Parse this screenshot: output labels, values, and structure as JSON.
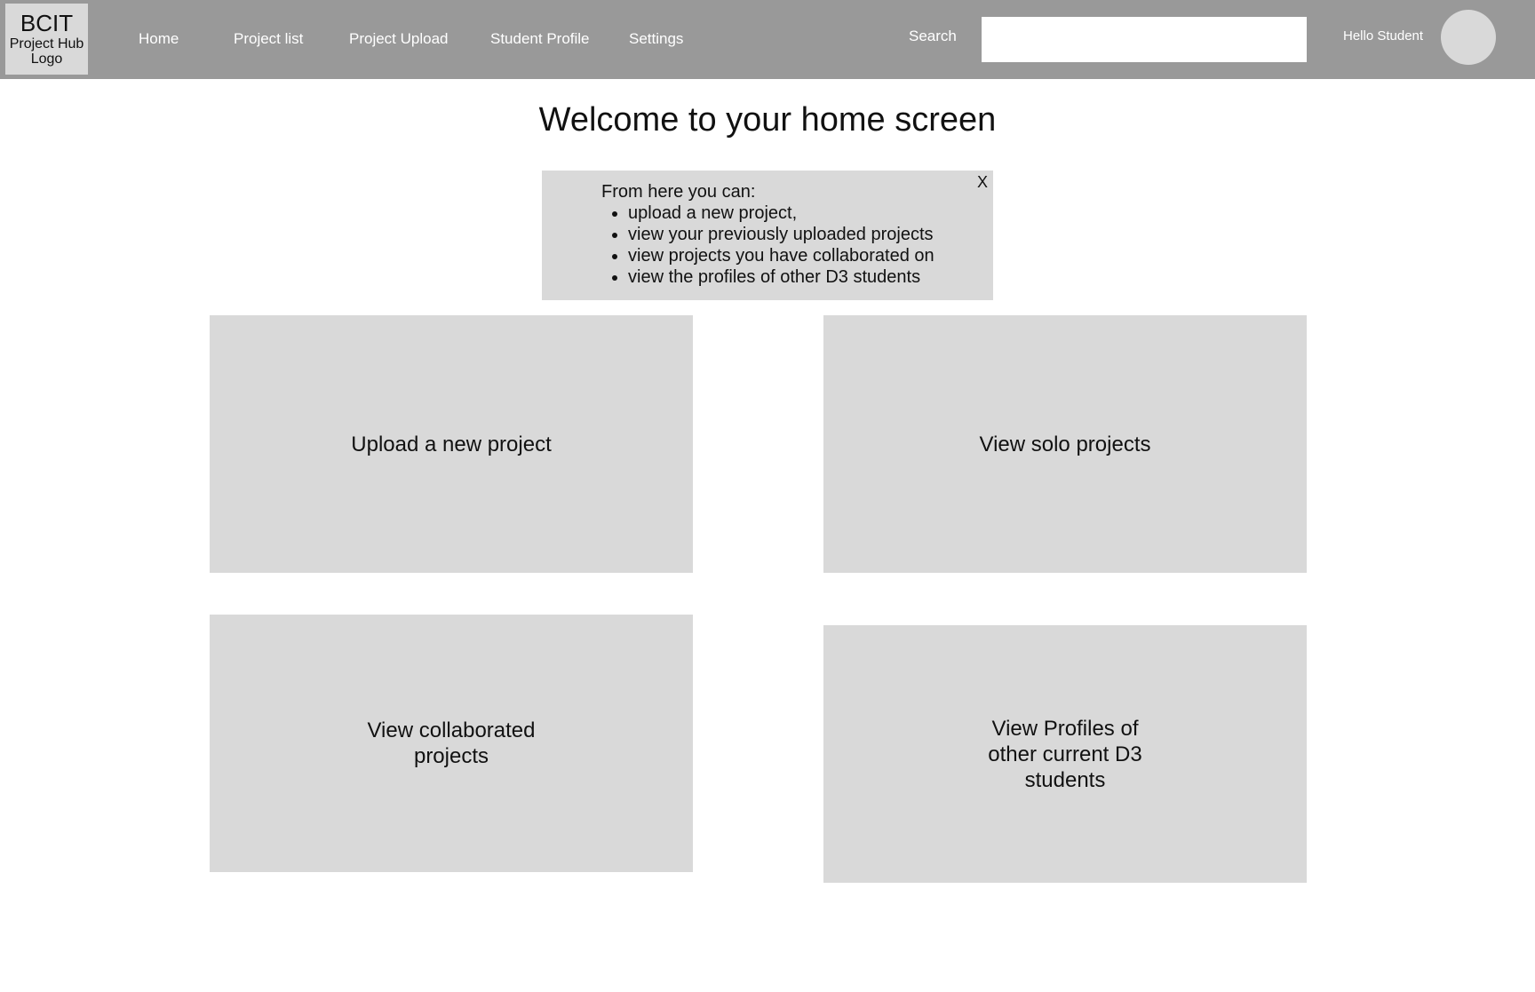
{
  "logo": {
    "line1": "BCIT",
    "line2": "Project Hub",
    "line3": "Logo"
  },
  "nav": {
    "home": "Home",
    "project_list": "Project list",
    "project_upload": "Project Upload",
    "student_profile": "Student Profile",
    "settings": "Settings"
  },
  "search": {
    "label": "Search",
    "value": "",
    "placeholder": ""
  },
  "user": {
    "greeting": "Hello Student"
  },
  "main": {
    "title": "Welcome to your home screen",
    "info": {
      "intro": "From here you can:",
      "items": [
        "upload a new project,",
        "view your previously uploaded projects",
        "view projects you have collaborated on",
        "view the profiles of other D3 students"
      ],
      "close_label": "X"
    },
    "tiles": {
      "upload": "Upload a new project",
      "solo": "View solo projects",
      "collab": "View collaborated projects",
      "profiles": "View Profiles of other current D3 students"
    }
  },
  "colors": {
    "navbar": "#999999",
    "panel": "#d9d9d9",
    "background": "#ffffff"
  }
}
